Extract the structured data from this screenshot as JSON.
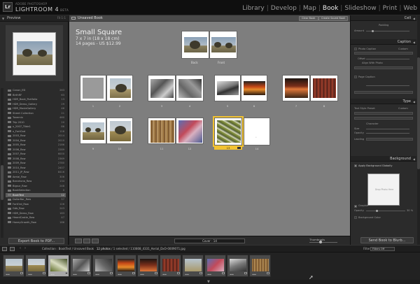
{
  "app": {
    "brand_small": "ADOBE PHOTOSHOP",
    "brand_big": "LIGHTROOM 4",
    "brand_beta": "BETA",
    "logo": "Lr"
  },
  "modules": [
    "Library",
    "Develop",
    "Map",
    "Book",
    "Slideshow",
    "Print",
    "Web"
  ],
  "active_module": "Book",
  "left_panel": {
    "preview_title": "Preview",
    "preview_opts": "Fit  1:1",
    "folders": [
      {
        "name": "Canon_ED",
        "count": "263"
      },
      {
        "name": "BirthRF",
        "count": "63"
      },
      {
        "name": "HDR_Book_Portfolio",
        "count": "13"
      },
      {
        "name": "HDR_Demo_Gallery",
        "count": "29"
      },
      {
        "name": "HDR_MovieGallery",
        "count": "46"
      },
      {
        "name": "Street Collection",
        "count": "21"
      },
      {
        "name": "Tonemix",
        "count": "460"
      },
      {
        "name": "Trip 2010",
        "count": "20"
      },
      {
        "name": "x_2007_Tilde1",
        "count": "86"
      },
      {
        "name": "x_FortGnd",
        "count": "116"
      },
      {
        "name": "2003_Raw",
        "count": "2014"
      },
      {
        "name": "2004_Raw",
        "count": "2010"
      },
      {
        "name": "2005_Raw",
        "count": "2186"
      },
      {
        "name": "2006_Raw",
        "count": "2289"
      },
      {
        "name": "2007_Raw",
        "count": "6000"
      },
      {
        "name": "2008_Raw",
        "count": "2369"
      },
      {
        "name": "2009_Raw",
        "count": "2780"
      },
      {
        "name": "2010_Raw",
        "count": "2407"
      },
      {
        "name": "2011_JP_Raw",
        "count": "8416"
      },
      {
        "name": "Aerial_Raw",
        "count": "306"
      },
      {
        "name": "Barcelona_Raw",
        "count": "134"
      },
      {
        "name": "Bigsur_Raw",
        "count": "248"
      },
      {
        "name": "BookSelection",
        "count": "0"
      },
      {
        "name": "BookTest",
        "count": "12"
      },
      {
        "name": "DollarBar_Raw",
        "count": "57"
      },
      {
        "name": "FortOrd_Raw",
        "count": "126"
      },
      {
        "name": "Gdb_Raw",
        "count": "243"
      },
      {
        "name": "HDR_Demo_Raw",
        "count": "183"
      },
      {
        "name": "HeardCastle_Raw",
        "count": "47"
      },
      {
        "name": "HoneyGrowth_Raw",
        "count": "186"
      }
    ],
    "selected_folder": "BookTest",
    "export_button": "Export Book to PDF..."
  },
  "center": {
    "tab_label": "Unsaved Book",
    "clear_book": "Clear Book",
    "create_saved": "Create Saved Book",
    "book_title": "Small Square",
    "book_size": "7 x 7 in (18 x 18 cm)",
    "book_pages": "14 pages - US $12.99",
    "cover_back": "Back",
    "cover_front": "Front",
    "page_numbers": [
      "1",
      "2",
      "3",
      "4",
      "5",
      "6",
      "7",
      "8",
      "9",
      "10",
      "11",
      "12",
      "13",
      "14"
    ],
    "cover_field": "Cover - 14",
    "thumbnails_label": "Thumbnails"
  },
  "right_panel": {
    "cell": "Cell",
    "padding": "Padding",
    "amount": "Amount",
    "caption": "Caption",
    "photo_caption": "Photo Caption",
    "custom": "Custom",
    "offset": "Offset",
    "align_photo": "Align With Photo",
    "page_caption": "Page Caption",
    "type": "Type",
    "text_style": "Text Style Preset",
    "character": "Character",
    "size": "Size",
    "opacity": "Opacity",
    "leading": "Leading",
    "background": "Background",
    "apply_bg_global": "Apply Background Globally",
    "drop_photo": "Drop Photo Here",
    "graphic": "Graphic",
    "bg_color": "Background Color",
    "opacity_value": "30 %",
    "send_button": "Send Book to Blurb..."
  },
  "filmstrip": {
    "path": "Collection : BookTest / Unsaved Book",
    "count": "12 photos",
    "file": "/ 1 selected / 110808_4331_Aerial_DxO-0009071.jpg",
    "filter_label": "Filter :",
    "filter_value": "Filters Off",
    "thumbs": 12
  }
}
